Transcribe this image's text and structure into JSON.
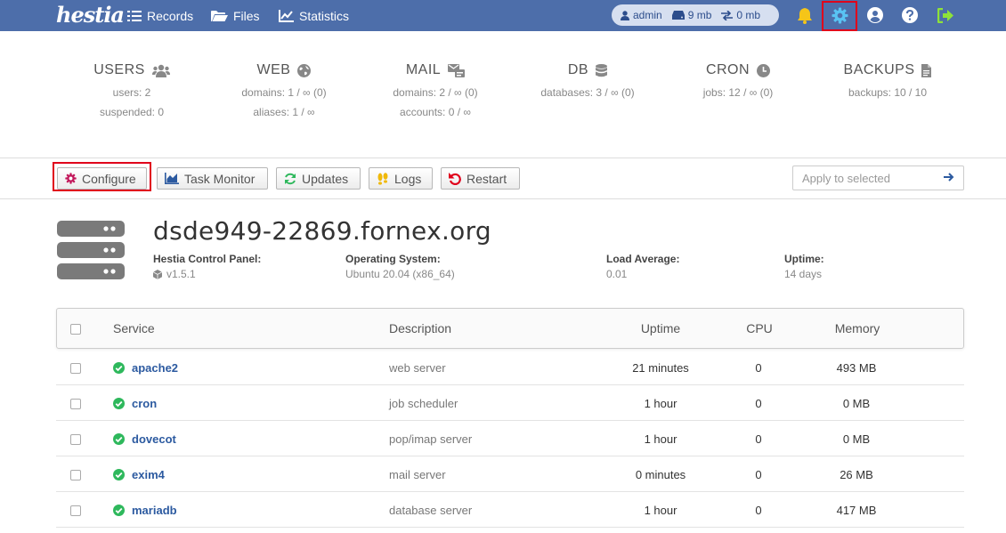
{
  "topbar": {
    "logo": "hestia",
    "nav": [
      {
        "label": "Records",
        "icon": "records-icon"
      },
      {
        "label": "Files",
        "icon": "folder-icon"
      },
      {
        "label": "Statistics",
        "icon": "chart-icon"
      }
    ],
    "user": {
      "name": "admin",
      "disk": "9 mb",
      "bandwidth": "0 mb"
    },
    "icons": [
      "bell-icon",
      "gear-icon",
      "user-circle-icon",
      "help-icon",
      "logout-icon"
    ]
  },
  "stats": [
    {
      "title": "USERS",
      "icon": "users-icon",
      "lines": [
        "users: 2",
        "suspended: 0"
      ]
    },
    {
      "title": "WEB",
      "icon": "globe-icon",
      "lines": [
        "domains: 1 / ∞ (0)",
        "aliases: 1 / ∞"
      ]
    },
    {
      "title": "MAIL",
      "icon": "mail-icon",
      "lines": [
        "domains: 2 / ∞ (0)",
        "accounts: 0 / ∞"
      ]
    },
    {
      "title": "DB",
      "icon": "database-icon",
      "lines": [
        "databases: 3 / ∞ (0)"
      ]
    },
    {
      "title": "CRON",
      "icon": "clock-icon",
      "lines": [
        "jobs: 12 / ∞ (0)"
      ]
    },
    {
      "title": "BACKUPS",
      "icon": "file-icon",
      "lines": [
        "backups: 10 / 10"
      ]
    }
  ],
  "toolbar": {
    "configure": "Configure",
    "task_monitor": "Task Monitor",
    "updates": "Updates",
    "logs": "Logs",
    "restart": "Restart",
    "apply_placeholder": "Apply to selected"
  },
  "server": {
    "hostname": "dsde949-22869.fornex.org",
    "panel_label": "Hestia Control Panel:",
    "panel_version": "v1.5.1",
    "os_label": "Operating System:",
    "os_value": "Ubuntu 20.04 (x86_64)",
    "load_label": "Load Average:",
    "load_value": "0.01",
    "uptime_label": "Uptime:",
    "uptime_value": "14 days"
  },
  "table": {
    "headers": {
      "service": "Service",
      "description": "Description",
      "uptime": "Uptime",
      "cpu": "CPU",
      "memory": "Memory"
    },
    "rows": [
      {
        "service": "apache2",
        "description": "web server",
        "uptime": "21 minutes",
        "cpu": "0",
        "memory": "493 MB"
      },
      {
        "service": "cron",
        "description": "job scheduler",
        "uptime": "1 hour",
        "cpu": "0",
        "memory": "0 MB"
      },
      {
        "service": "dovecot",
        "description": "pop/imap server",
        "uptime": "1 hour",
        "cpu": "0",
        "memory": "0 MB"
      },
      {
        "service": "exim4",
        "description": "mail server",
        "uptime": "0 minutes",
        "cpu": "0",
        "memory": "26 MB"
      },
      {
        "service": "mariadb",
        "description": "database server",
        "uptime": "1 hour",
        "cpu": "0",
        "memory": "417 MB"
      }
    ]
  },
  "colors": {
    "topbar": "#4d6eaa",
    "highlight": "#e0001b",
    "ok": "#2eb85c",
    "link": "#2c5aa0"
  }
}
